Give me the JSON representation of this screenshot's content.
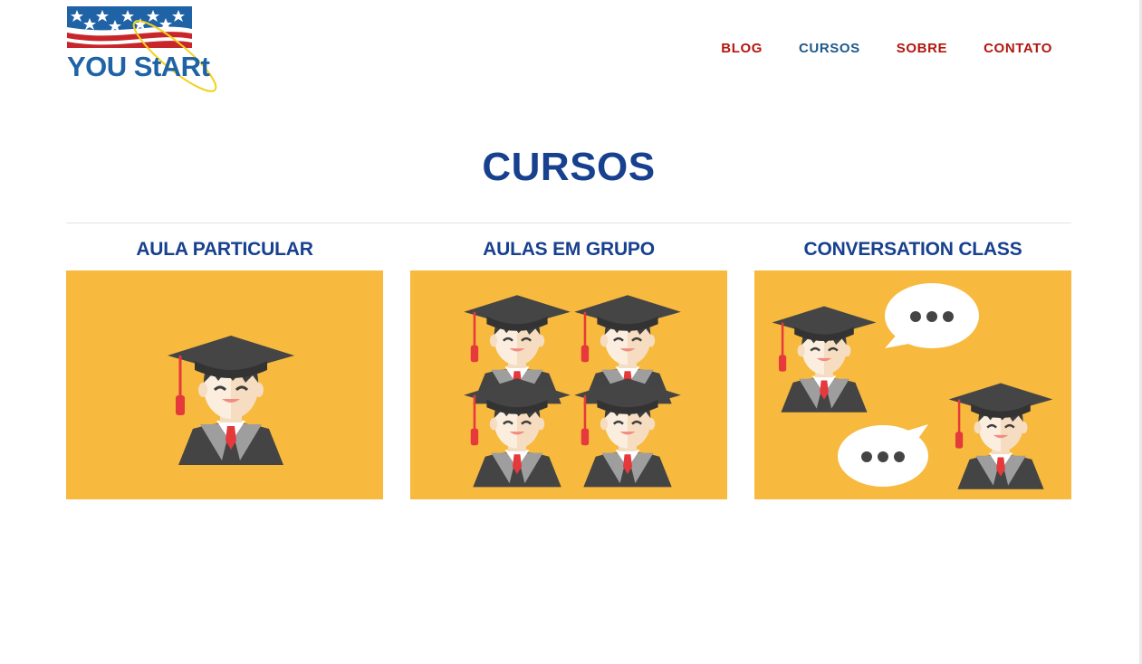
{
  "brand": {
    "logo_text": "YOU StARt",
    "logo_alt": "You Start logo"
  },
  "nav": {
    "items": [
      {
        "label": "BLOG",
        "active": false
      },
      {
        "label": "CURSOS",
        "active": true
      },
      {
        "label": "SOBRE",
        "active": false
      },
      {
        "label": "CONTATO",
        "active": false
      }
    ]
  },
  "main": {
    "title": "CURSOS",
    "courses": [
      {
        "title": "AULA PARTICULAR",
        "illustration": "single-graduate"
      },
      {
        "title": "AULAS EM GRUPO",
        "illustration": "group-of-graduates"
      },
      {
        "title": "CONVERSATION CLASS",
        "illustration": "graduates-conversation"
      }
    ]
  },
  "colors": {
    "nav_red": "#b3160f",
    "nav_active_blue": "#1e5a8c",
    "title_blue": "#17408f",
    "card_bg": "#f7b93e",
    "logo_blue": "#1f63a6",
    "logo_red": "#c8262a"
  }
}
